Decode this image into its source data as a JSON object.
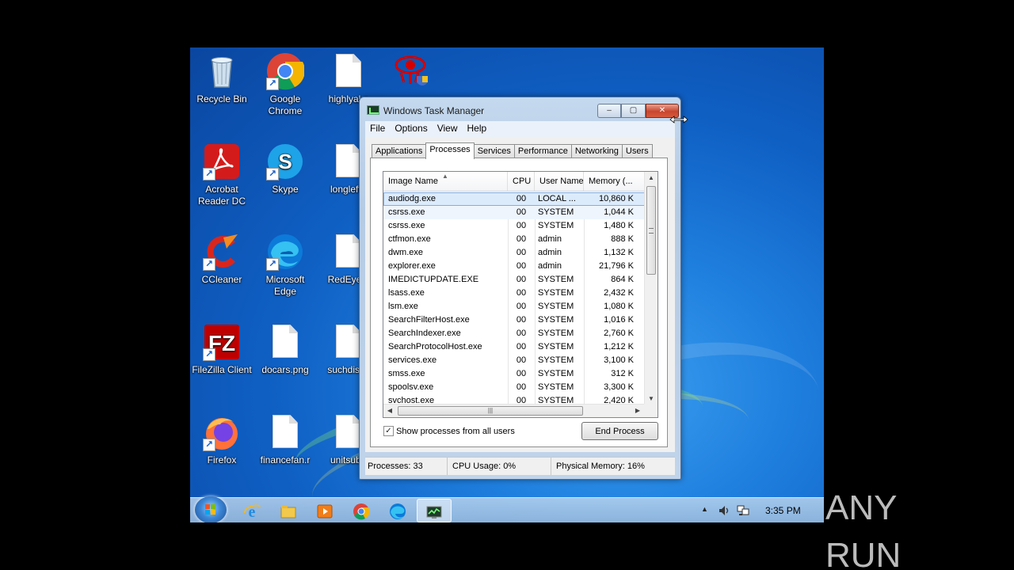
{
  "desktop": {
    "icons": [
      {
        "label": "Recycle Bin",
        "icon": "recycle-bin-icon"
      },
      {
        "label": "Google Chrome",
        "icon": "chrome-icon"
      },
      {
        "label": "highlyal.p",
        "icon": "file-icon"
      },
      {
        "label": "",
        "icon": "red-eye-shield-icon"
      },
      {
        "label": "Acrobat Reader DC",
        "icon": "acrobat-icon"
      },
      {
        "label": "Skype",
        "icon": "skype-icon"
      },
      {
        "label": "longleft.r",
        "icon": "file-icon"
      },
      {
        "label": "CCleaner",
        "icon": "ccleaner-icon"
      },
      {
        "label": "Microsoft Edge",
        "icon": "edge-icon"
      },
      {
        "label": "RedEye.b",
        "icon": "file-icon"
      },
      {
        "label": "FileZilla Client",
        "icon": "filezilla-icon"
      },
      {
        "label": "docars.png",
        "icon": "file-icon"
      },
      {
        "label": "suchdiscu",
        "icon": "file-icon"
      },
      {
        "label": "Firefox",
        "icon": "firefox-icon"
      },
      {
        "label": "financefan.r",
        "icon": "file-icon"
      },
      {
        "label": "unitsub.r",
        "icon": "file-icon"
      }
    ]
  },
  "window": {
    "title": "Windows Task Manager",
    "controls": {
      "minimize": "‒",
      "maximize": "▢",
      "close": "✕"
    },
    "menu": [
      "File",
      "Options",
      "View",
      "Help"
    ],
    "tabs": [
      "Applications",
      "Processes",
      "Services",
      "Performance",
      "Networking",
      "Users"
    ],
    "active_tab": "Processes",
    "columns": [
      "Image Name",
      "CPU",
      "User Name",
      "Memory (..."
    ],
    "processes": [
      {
        "name": "audiodg.exe",
        "cpu": "00",
        "user": "LOCAL ...",
        "mem": "10,860 K"
      },
      {
        "name": "csrss.exe",
        "cpu": "00",
        "user": "SYSTEM",
        "mem": "1,044 K"
      },
      {
        "name": "csrss.exe",
        "cpu": "00",
        "user": "SYSTEM",
        "mem": "1,480 K"
      },
      {
        "name": "ctfmon.exe",
        "cpu": "00",
        "user": "admin",
        "mem": "888 K"
      },
      {
        "name": "dwm.exe",
        "cpu": "00",
        "user": "admin",
        "mem": "1,132 K"
      },
      {
        "name": "explorer.exe",
        "cpu": "00",
        "user": "admin",
        "mem": "21,796 K"
      },
      {
        "name": "IMEDICTUPDATE.EXE",
        "cpu": "00",
        "user": "SYSTEM",
        "mem": "864 K"
      },
      {
        "name": "lsass.exe",
        "cpu": "00",
        "user": "SYSTEM",
        "mem": "2,432 K"
      },
      {
        "name": "lsm.exe",
        "cpu": "00",
        "user": "SYSTEM",
        "mem": "1,080 K"
      },
      {
        "name": "SearchFilterHost.exe",
        "cpu": "00",
        "user": "SYSTEM",
        "mem": "1,016 K"
      },
      {
        "name": "SearchIndexer.exe",
        "cpu": "00",
        "user": "SYSTEM",
        "mem": "2,760 K"
      },
      {
        "name": "SearchProtocolHost.exe",
        "cpu": "00",
        "user": "SYSTEM",
        "mem": "1,212 K"
      },
      {
        "name": "services.exe",
        "cpu": "00",
        "user": "SYSTEM",
        "mem": "3,100 K"
      },
      {
        "name": "smss.exe",
        "cpu": "00",
        "user": "SYSTEM",
        "mem": "312 K"
      },
      {
        "name": "spoolsv.exe",
        "cpu": "00",
        "user": "SYSTEM",
        "mem": "3,300 K"
      },
      {
        "name": "svchost.exe",
        "cpu": "00",
        "user": "SYSTEM",
        "mem": "2,420 K"
      }
    ],
    "show_all_users_label": "Show processes from all users",
    "show_all_users_checked": true,
    "end_process_label": "End Process",
    "status": {
      "processes": "Processes: 33",
      "cpu": "CPU Usage: 0%",
      "memory": "Physical Memory: 16%"
    }
  },
  "taskbar": {
    "start_icon": "windows-start-orb-icon",
    "pinned": [
      "internet-explorer-icon",
      "file-explorer-icon",
      "media-player-icon",
      "chrome-icon",
      "edge-icon",
      "task-manager-icon"
    ],
    "tray_icons": [
      "show-hidden-arrow-icon",
      "volume-icon",
      "network-icon"
    ],
    "clock": "3:35 PM"
  },
  "watermark": "ANY RUN",
  "colors": {
    "desktop_blue": "#1f7fde",
    "selection": "#dcebfc",
    "close_red": "#c9452d"
  }
}
